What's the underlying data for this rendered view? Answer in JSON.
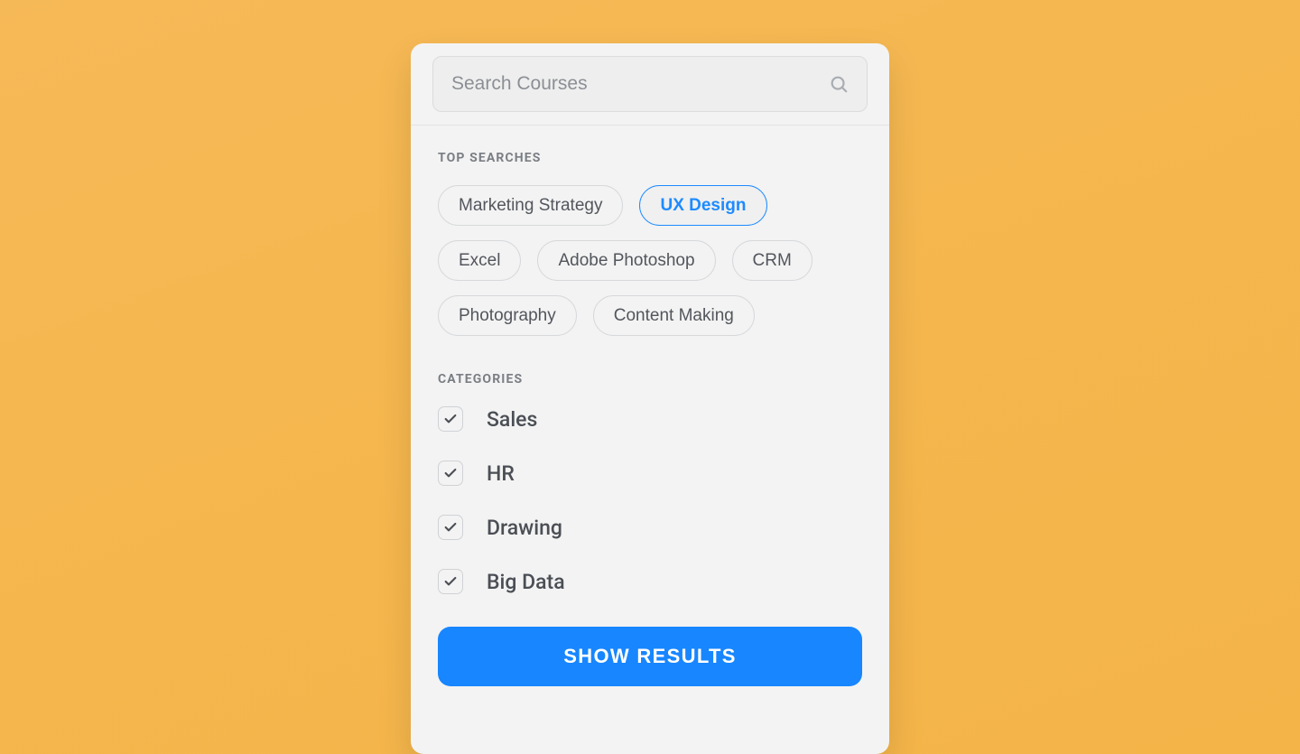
{
  "search": {
    "placeholder": "Search Courses",
    "value": ""
  },
  "topSearches": {
    "heading": "TOP SEARCHES",
    "items": [
      {
        "label": "Marketing Strategy",
        "active": false
      },
      {
        "label": "UX Design",
        "active": true
      },
      {
        "label": "Excel",
        "active": false
      },
      {
        "label": "Adobe Photoshop",
        "active": false
      },
      {
        "label": "CRM",
        "active": false
      },
      {
        "label": "Photography",
        "active": false
      },
      {
        "label": "Content Making",
        "active": false
      }
    ]
  },
  "categories": {
    "heading": "CATEGORIES",
    "items": [
      {
        "label": "Sales",
        "checked": true
      },
      {
        "label": "HR",
        "checked": true
      },
      {
        "label": "Drawing",
        "checked": true
      },
      {
        "label": "Big Data",
        "checked": true
      }
    ]
  },
  "actions": {
    "showResults": "SHOW RESULTS"
  },
  "colors": {
    "accent": "#1786ff",
    "chipActive": "#1d8bff",
    "background": "#f5b74f"
  }
}
